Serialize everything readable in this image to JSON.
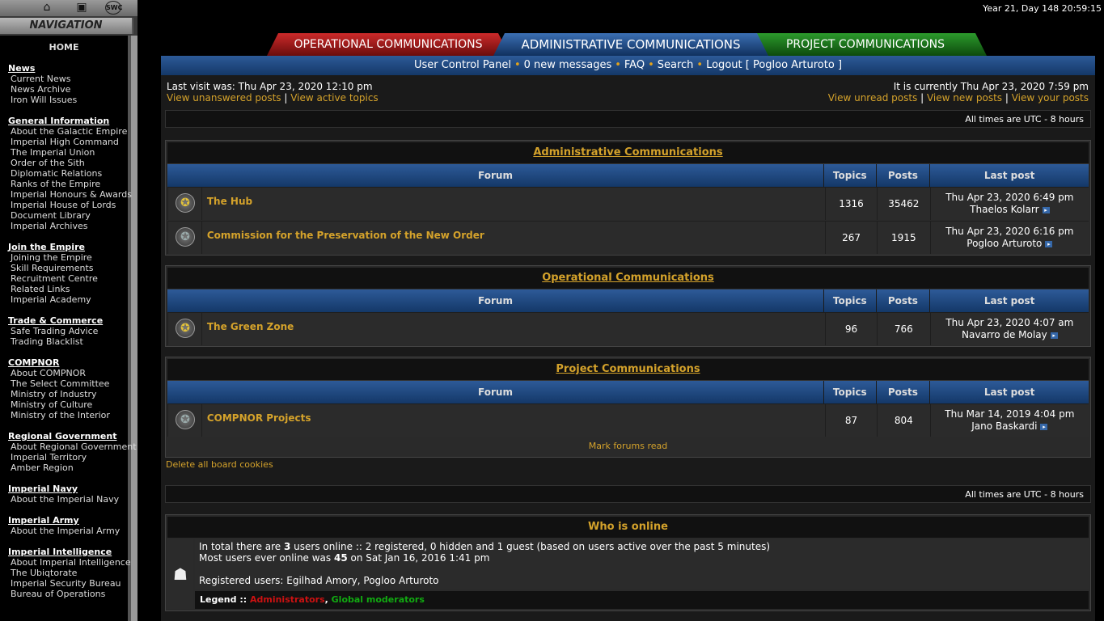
{
  "clock": "Year 21, Day 148 20:59:15",
  "sidebar": {
    "icons": [
      "home-icon",
      "user-card-icon",
      "swc-logo-icon"
    ],
    "swc_text": "SWC",
    "nav_title": "NAVIGATION",
    "home": "HOME",
    "sections": [
      {
        "title": "News",
        "items": [
          "Current News",
          "News Archive",
          "Iron Will Issues"
        ]
      },
      {
        "title": "General Information",
        "items": [
          "About the Galactic Empire",
          "Imperial High Command",
          "The Imperial Union",
          "Order of the Sith",
          "Diplomatic Relations",
          "Ranks of the Empire",
          "Imperial Honours & Awards",
          "Imperial House of Lords",
          "Document Library",
          "Imperial Archives"
        ]
      },
      {
        "title": "Join the Empire",
        "items": [
          "Joining the Empire",
          "Skill Requirements",
          "Recruitment Centre",
          "Related Links",
          "Imperial Academy"
        ]
      },
      {
        "title": "Trade & Commerce",
        "items": [
          "Safe Trading Advice",
          "Trading Blacklist"
        ]
      },
      {
        "title": "COMPNOR",
        "items": [
          "About COMPNOR",
          "The Select Committee",
          "Ministry of Industry",
          "Ministry of Culture",
          "Ministry of the Interior"
        ]
      },
      {
        "title": "Regional Government",
        "items": [
          "About Regional Government",
          "Imperial Territory",
          "Amber Region"
        ]
      },
      {
        "title": "Imperial Navy",
        "items": [
          "About the Imperial Navy"
        ]
      },
      {
        "title": "Imperial Army",
        "items": [
          "About the Imperial Army"
        ]
      },
      {
        "title": "Imperial Intelligence",
        "items": [
          "About Imperial Intelligence",
          "The Ubiqtorate",
          "Imperial Security Bureau",
          "Bureau of Operations"
        ]
      }
    ]
  },
  "tabs": {
    "operational": "OPERATIONAL COMMUNICATIONS",
    "administrative": "ADMINISTRATIVE COMMUNICATIONS",
    "project": "PROJECT COMMUNICATIONS"
  },
  "ucp": {
    "user_control_panel": "User Control Panel",
    "messages": "0 new messages",
    "faq": "FAQ",
    "search": "Search",
    "logout": "Logout [ Pogloo Arturoto ]"
  },
  "visit": {
    "last_visit": "Last visit was: Thu Apr 23, 2020 12:10 pm",
    "unanswered": "View unanswered posts",
    "active": "View active topics",
    "current": "It is currently Thu Apr 23, 2020 7:59 pm",
    "unread": "View unread posts",
    "new_posts": "View new posts",
    "your_posts": "View your posts",
    "separator": " | "
  },
  "timezone": "All times are UTC - 8 hours",
  "headers": {
    "forum": "Forum",
    "topics": "Topics",
    "posts": "Posts",
    "last_post": "Last post"
  },
  "categories": [
    {
      "title": "Administrative Communications",
      "forums": [
        {
          "name": "The Hub",
          "topics": "1316",
          "posts": "35462",
          "last_date": "Thu Apr 23, 2020 6:49 pm",
          "last_user": "Thaelos Kolarr",
          "icon": "imperial-star-icon"
        },
        {
          "name": "Commission for the Preservation of the New Order",
          "topics": "267",
          "posts": "1915",
          "last_date": "Thu Apr 23, 2020 6:16 pm",
          "last_user": "Pogloo Arturoto",
          "icon": "imperial-star-read-icon"
        }
      ]
    },
    {
      "title": "Operational Communications",
      "forums": [
        {
          "name": "The Green Zone",
          "topics": "96",
          "posts": "766",
          "last_date": "Thu Apr 23, 2020 4:07 am",
          "last_user": "Navarro de Molay",
          "icon": "imperial-star-icon"
        }
      ]
    },
    {
      "title": "Project Communications",
      "forums": [
        {
          "name": "COMPNOR Projects",
          "topics": "87",
          "posts": "804",
          "last_date": "Thu Mar 14, 2019 4:04 pm",
          "last_user": "Jano Baskardi",
          "icon": "imperial-star-read-icon"
        }
      ]
    }
  ],
  "mark_read": "Mark forums read",
  "delete_cookies": "Delete all board cookies",
  "who": {
    "title": "Who is online",
    "line1_prefix": "In total there are ",
    "line1_count": "3",
    "line1_suffix": " users online :: 2 registered, 0 hidden and 1 guest (based on users active over the past 5 minutes)",
    "line2_prefix": "Most users ever online was ",
    "line2_count": "45",
    "line2_suffix": " on Sat Jan 16, 2016 1:41 pm",
    "registered": "Registered users: Egilhad Amory, Pogloo Arturoto",
    "legend_label": "Legend :: ",
    "legend_admin": "Administrators",
    "legend_comma": ", ",
    "legend_mods": "Global moderators",
    "admin_color": "#cc1111",
    "mod_color": "#11aa11"
  }
}
